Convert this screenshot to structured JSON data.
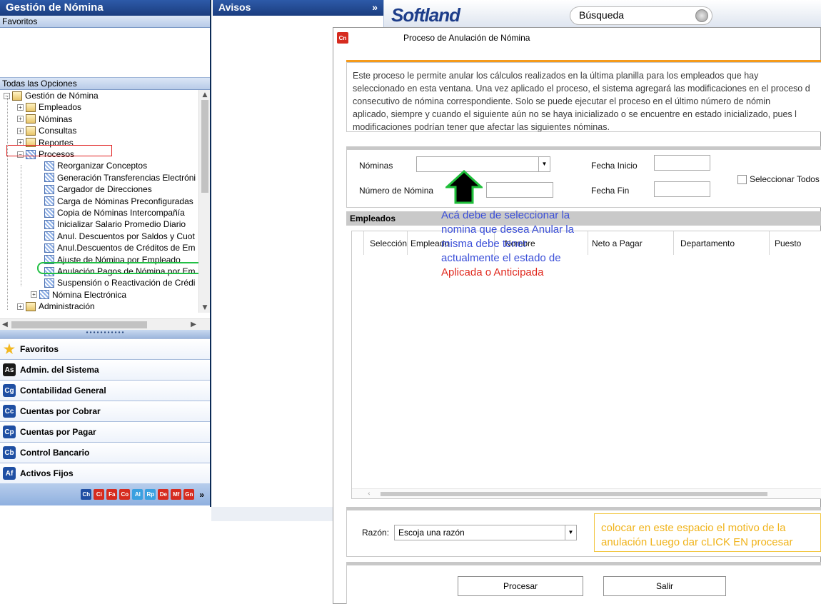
{
  "left_pane": {
    "title": "Gestión de Nómina",
    "favorites_header": "Favoritos",
    "all_options_header": "Todas las Opciones",
    "tree": [
      {
        "label": "Gestión de Nómina",
        "expander": "−",
        "icon": "folder-search-icon"
      },
      {
        "label": "Empleados",
        "expander": "+",
        "icon": "edit-folder-icon"
      },
      {
        "label": "Nóminas",
        "expander": "+",
        "icon": "edit-folder-icon"
      },
      {
        "label": "Consultas",
        "expander": "+",
        "icon": "folder-search-icon"
      },
      {
        "label": "Reportes",
        "expander": "+",
        "icon": "report-folder-icon"
      },
      {
        "label": "Procesos",
        "expander": "−",
        "icon": "process-folder-icon"
      },
      {
        "label": "Reorganizar Conceptos",
        "icon": "process-icon"
      },
      {
        "label": "Generación Transferencias Electróni",
        "icon": "process-icon"
      },
      {
        "label": "Cargador de Direcciones",
        "icon": "process-icon"
      },
      {
        "label": "Carga de Nóminas Preconfiguradas",
        "icon": "process-icon"
      },
      {
        "label": "Copia de Nóminas Intercompañía",
        "icon": "process-icon"
      },
      {
        "label": "Inicializar Salario Promedio Diario",
        "icon": "process-icon"
      },
      {
        "label": "Anul. Descuentos por Saldos y Cuot",
        "icon": "process-icon"
      },
      {
        "label": "Anul.Descuentos de Créditos de Em",
        "icon": "process-icon"
      },
      {
        "label": "Ajuste de Nómina por Empleado",
        "icon": "process-icon"
      },
      {
        "label": "Anulación Pagos de Nómina por Em",
        "icon": "process-icon"
      },
      {
        "label": "Suspensión o Reactivación de Crédi",
        "icon": "process-icon"
      },
      {
        "label": "Nómina Electrónica",
        "expander": "+",
        "icon": "process-folder-icon"
      },
      {
        "label": "Administración",
        "expander": "+",
        "icon": "report-folder-icon"
      }
    ],
    "modules": [
      {
        "label": "Favoritos",
        "badge": "★",
        "color": "#f3b820"
      },
      {
        "label": "Admin. del Sistema",
        "badge": "As",
        "color": "#1a1a1a"
      },
      {
        "label": "Contabilidad General",
        "badge": "Cg",
        "color": "#1f4fa3"
      },
      {
        "label": "Cuentas por Cobrar",
        "badge": "Cc",
        "color": "#1f4fa3"
      },
      {
        "label": "Cuentas por Pagar",
        "badge": "Cp",
        "color": "#1f4fa3"
      },
      {
        "label": "Control Bancario",
        "badge": "Cb",
        "color": "#1f4fa3"
      },
      {
        "label": "Activos Fijos",
        "badge": "Af",
        "color": "#1f4fa3"
      }
    ],
    "mini_modules": [
      {
        "label": "Ch",
        "color": "#1f4fa3"
      },
      {
        "label": "Ci",
        "color": "#d62b1f"
      },
      {
        "label": "Fa",
        "color": "#d62b1f"
      },
      {
        "label": "Co",
        "color": "#d62b1f"
      },
      {
        "label": "Al",
        "color": "#3aa0e0"
      },
      {
        "label": "Rp",
        "color": "#3aa0e0"
      },
      {
        "label": "De",
        "color": "#d62b1f"
      },
      {
        "label": "Mf",
        "color": "#d62b1f"
      },
      {
        "label": "Gn",
        "color": "#d62b1f"
      }
    ]
  },
  "avisos": {
    "title": "Avisos",
    "collapse_glyph": "»"
  },
  "topbar": {
    "logo": "Softland",
    "search_placeholder": "Búsqueda"
  },
  "dialog": {
    "badge": "Cn",
    "title": "Proceso de Anulación de Nómina",
    "description_lines": [
      "Este proceso le permite anular los cálculos realizados en la última planilla para los empleados que hay",
      "seleccionado en esta ventana. Una vez aplicado el proceso, el sistema agregará las modificaciones en el proceso d",
      "consecutivo de nómina correspondiente. Solo se puede ejecutar el proceso en el último número de nómin",
      "aplicado, siempre y cuando el siguiente aún no se haya inicializado o se encuentre en estado inicializado, pues l",
      "modificaciones podrían tener que afectar las siguientes nóminas."
    ],
    "labels": {
      "nominas": "Nóminas",
      "numero_nomina": "Número de Nómina",
      "fecha_inicio": "Fecha Inicio",
      "fecha_fin": "Fecha Fin",
      "seleccionar_todos": "Seleccionar Todos"
    },
    "nominas_value": "",
    "numero_nomina_value": "",
    "fecha_inicio_value": "",
    "fecha_fin_value": "",
    "empleados_header": "Empleados",
    "columns": [
      "Selección",
      "Empleado",
      "Nombre",
      "Neto a Pagar",
      "Departamento",
      "Puesto"
    ],
    "razon_label": "Razón:",
    "razon_value": "Escoja una razón",
    "procesar": "Procesar",
    "salir": "Salir"
  },
  "annotations": {
    "blue_lines": [
      "Acá debe de seleccionar la",
      "nomina que desea Anular la",
      "misma debe tener",
      "actualmente el estado de"
    ],
    "red_line": "Aplicada o Anticipada",
    "yellow_lines": [
      "colocar en este espacio el motivo de la",
      "anulación Luego dar cLICK EN procesar"
    ]
  }
}
